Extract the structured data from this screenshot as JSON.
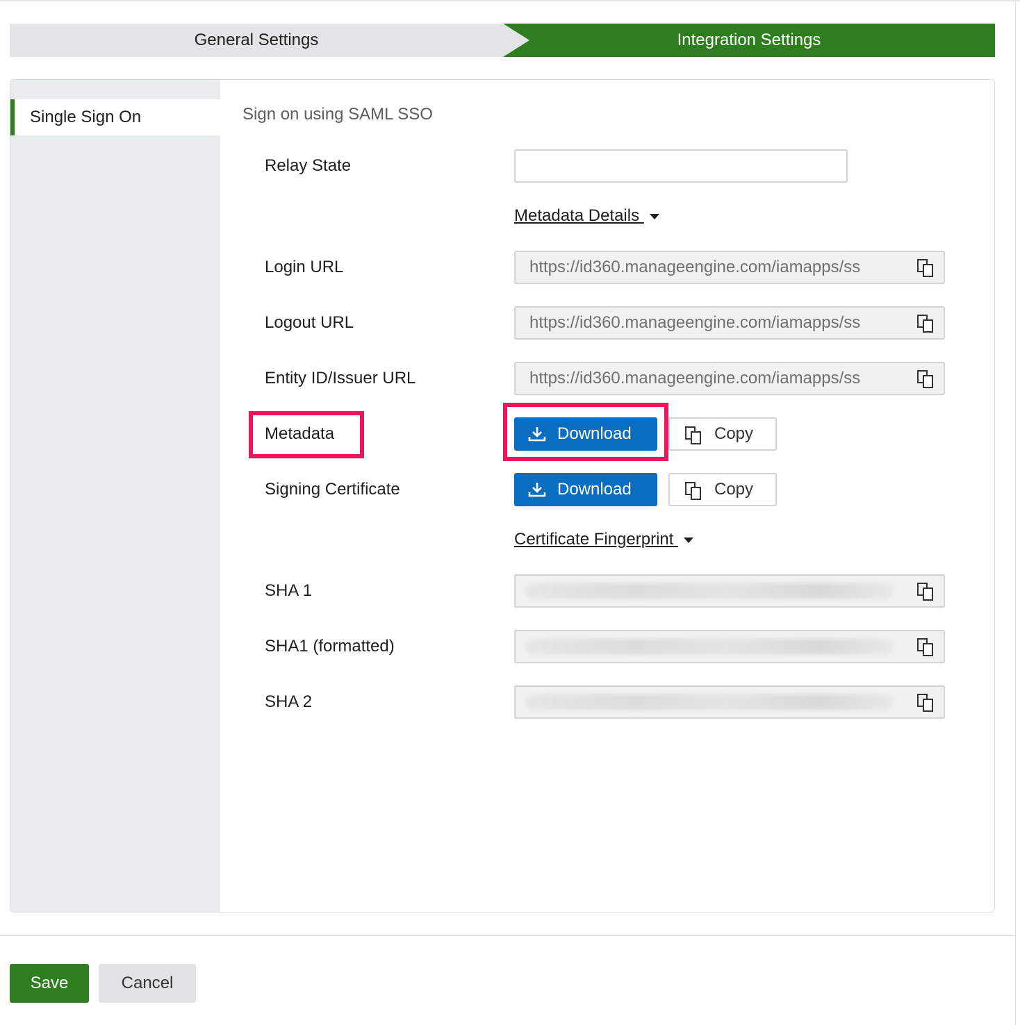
{
  "steps": {
    "general": "General Settings",
    "integration": "Integration Settings",
    "active_color": "#2e7d1f",
    "inactive_color": "#e3e4e5"
  },
  "sidebar": {
    "items": [
      {
        "label": "Single Sign On"
      }
    ]
  },
  "main": {
    "section_title": "Sign on using SAML SSO",
    "relay_state": {
      "label": "Relay State",
      "value": ""
    },
    "metadata_details_toggle": "Metadata Details",
    "login_url": {
      "label": "Login URL",
      "value": "https://id360.manageengine.com/iamapps/ss"
    },
    "logout_url": {
      "label": "Logout URL",
      "value": "https://id360.manageengine.com/iamapps/ss"
    },
    "entity_id": {
      "label": "Entity ID/Issuer URL",
      "value": "https://id360.manageengine.com/iamapps/ss"
    },
    "metadata": {
      "label": "Metadata",
      "download_label": "Download",
      "copy_label": "Copy"
    },
    "signing_certificate": {
      "label": "Signing Certificate",
      "download_label": "Download",
      "copy_label": "Copy"
    },
    "certificate_fingerprint_toggle": "Certificate Fingerprint",
    "sha1": {
      "label": "SHA 1"
    },
    "sha1_formatted": {
      "label": "SHA1 (formatted)"
    },
    "sha2": {
      "label": "SHA 2"
    }
  },
  "footer": {
    "save_label": "Save",
    "cancel_label": "Cancel"
  },
  "colors": {
    "primary_blue": "#0a6ec0",
    "highlight": "#f0145a"
  },
  "icons": [
    "download-icon",
    "copy-icon",
    "caret-down-icon"
  ]
}
